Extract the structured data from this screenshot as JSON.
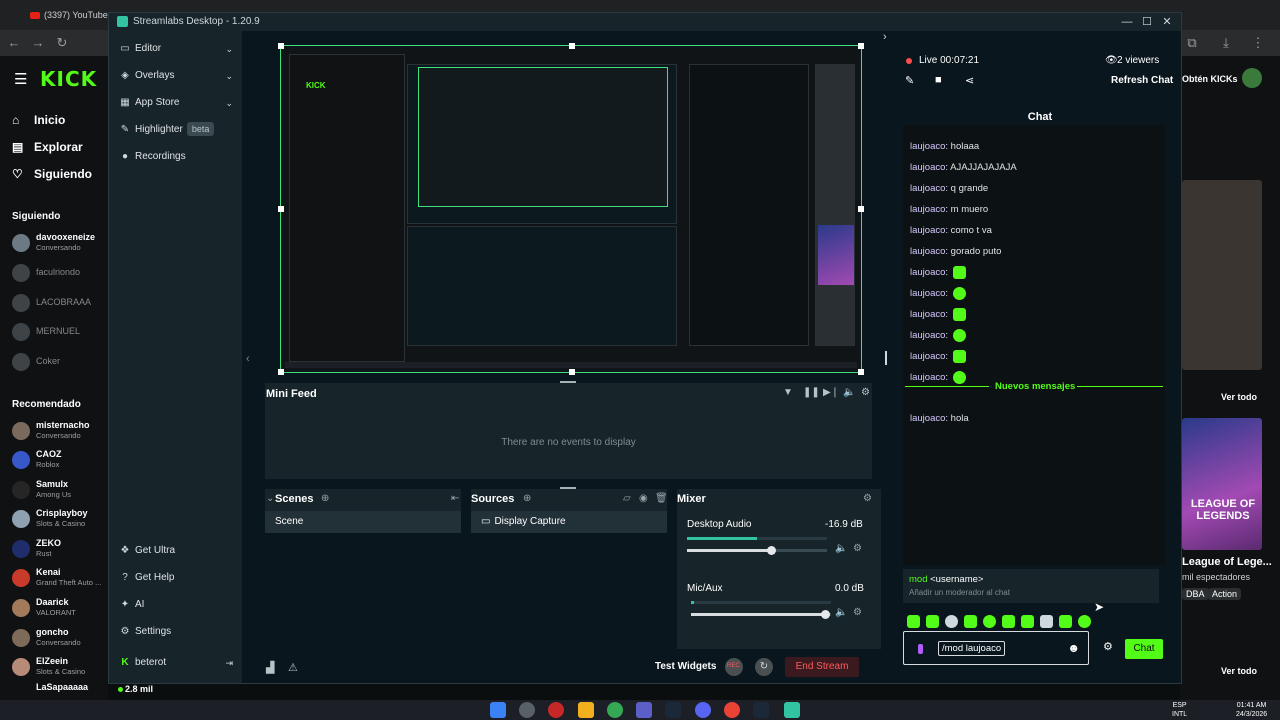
{
  "browser": {
    "tab_title": "(3397) YouTube"
  },
  "kick": {
    "logo": "KICK",
    "nav": [
      {
        "label": "Inicio",
        "icon": "home-icon"
      },
      {
        "label": "Explorar",
        "icon": "compass-icon"
      },
      {
        "label": "Siguiendo",
        "icon": "heart-icon"
      }
    ],
    "following_title": "Siguiendo",
    "following": [
      {
        "name": "davooxeneize",
        "sub": "Conversando",
        "online": true
      },
      {
        "name": "faculriondo",
        "sub": "",
        "online": false
      },
      {
        "name": "LACOBRAAA",
        "sub": "",
        "online": false
      },
      {
        "name": "MERNUEL",
        "sub": "",
        "online": false
      },
      {
        "name": "Coker",
        "sub": "",
        "online": false
      }
    ],
    "recommended_title": "Recomendado",
    "recommended": [
      {
        "name": "misternacho",
        "sub": "Conversando"
      },
      {
        "name": "CAOZ",
        "sub": "Roblox"
      },
      {
        "name": "Samulx",
        "sub": "Among Us"
      },
      {
        "name": "Crisplayboy",
        "sub": "Slots & Casino"
      },
      {
        "name": "ZEKO",
        "sub": "Rust"
      },
      {
        "name": "Kenai",
        "sub": "Grand Theft Auto ..."
      },
      {
        "name": "Daarick",
        "sub": "VALORANT"
      },
      {
        "name": "goncho",
        "sub": "Conversando"
      },
      {
        "name": "ElZeein",
        "sub": "Slots & Casino"
      },
      {
        "name": "LaSapaaaaa",
        "sub": ""
      }
    ],
    "footer_viewers": "2.8 mil",
    "right": {
      "get_kicks": "Obtén KICKs",
      "ver_todo": "Ver todo",
      "stream_title": "LEAGUE OF LEGENDS",
      "card_title": "League of Lege...",
      "card_viewers": "mil espectadores",
      "tags": [
        "DBA",
        "Action"
      ]
    }
  },
  "streamlabs": {
    "title": "Streamlabs Desktop - 1.20.9",
    "nav": [
      {
        "label": "Editor",
        "icon": "editor-icon",
        "chevron": true
      },
      {
        "label": "Overlays",
        "icon": "overlays-icon",
        "chevron": true
      },
      {
        "label": "App Store",
        "icon": "store-icon",
        "chevron": true
      },
      {
        "label": "Highlighter",
        "icon": "highlighter-icon",
        "badge": "beta"
      },
      {
        "label": "Recordings",
        "icon": "record-icon"
      }
    ],
    "nav_bottom": [
      {
        "label": "Get Ultra",
        "icon": "ultra-icon"
      },
      {
        "label": "Get Help",
        "icon": "help-icon"
      },
      {
        "label": "AI",
        "icon": "ai-icon"
      },
      {
        "label": "Settings",
        "icon": "gear-icon"
      }
    ],
    "user": "beterot",
    "mini_feed": {
      "title": "Mini Feed",
      "empty": "There are no events to display"
    },
    "scenes": {
      "title": "Scenes",
      "items": [
        "Scene"
      ]
    },
    "sources": {
      "title": "Sources",
      "items": [
        "Display Capture"
      ]
    },
    "mixer": {
      "title": "Mixer",
      "channels": [
        {
          "name": "Desktop Audio",
          "value": "-16.9 dB",
          "meter": 0.5,
          "volume": 0.6
        },
        {
          "name": "Mic/Aux",
          "value": "0.0 dB",
          "meter": 0.02,
          "volume": 0.96
        }
      ]
    },
    "bottom": {
      "test_widgets": "Test Widgets",
      "rec": "REC",
      "end_stream": "End Stream"
    },
    "chat": {
      "live": "Live 00:07:21",
      "viewers": "2 viewers",
      "refresh": "Refresh Chat",
      "title": "Chat",
      "messages": [
        {
          "user": "laujoaco",
          "text": "holaaa",
          "emote": false
        },
        {
          "user": "laujoaco",
          "text": "AJAJJAJAJAJA",
          "emote": false
        },
        {
          "user": "laujoaco",
          "text": "q grande",
          "emote": false
        },
        {
          "user": "laujoaco",
          "text": "m muero",
          "emote": false
        },
        {
          "user": "laujoaco",
          "text": "como t va",
          "emote": false
        },
        {
          "user": "laujoaco",
          "text": "gorado puto",
          "emote": false
        },
        {
          "user": "laujoaco",
          "text": "",
          "emote": true
        },
        {
          "user": "laujoaco",
          "text": "",
          "emote": true
        },
        {
          "user": "laujoaco",
          "text": "",
          "emote": true
        },
        {
          "user": "laujoaco",
          "text": "",
          "emote": true
        },
        {
          "user": "laujoaco",
          "text": "",
          "emote": true
        },
        {
          "user": "laujoaco",
          "text": "",
          "emote": true
        }
      ],
      "new_messages": "Nuevos mensajes",
      "after_new": {
        "user": "laujoaco",
        "text": "hola"
      },
      "suggest_cmd": "mod",
      "suggest_arg": "<username>",
      "suggest_desc": "Añadir un moderador al chat",
      "input_value": "/mod laujoaco",
      "send": "Chat"
    }
  },
  "taskbar": {
    "lang_top": "ESP",
    "lang_bottom": "INTL",
    "time": "01:41 AM",
    "date": "24/3/2026"
  }
}
